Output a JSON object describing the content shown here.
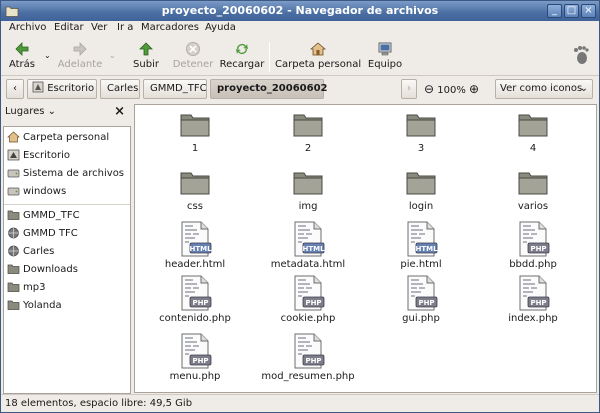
{
  "window": {
    "title": "proyecto_20060602 - Navegador de archivos"
  },
  "menu": [
    "Archivo",
    "Editar",
    "Ver",
    "Ir a",
    "Marcadores",
    "Ayuda"
  ],
  "toolbar": {
    "back": "Atrás",
    "forward": "Adelante",
    "up": "Subir",
    "stop": "Detener",
    "reload": "Recargar",
    "home": "Carpeta personal",
    "computer": "Equipo"
  },
  "location": {
    "crumbs": [
      "Escritorio",
      "Carles",
      "GMMD_TFC",
      "proyecto_20060602"
    ],
    "zoom": "100%",
    "view": "Ver como iconos"
  },
  "sidebar": {
    "header": "Lugares",
    "places": [
      "Carpeta personal",
      "Escritorio",
      "Sistema de archivos",
      "windows"
    ],
    "bookmarks": [
      "GMMD_TFC",
      "GMMD TFC",
      "Carles",
      "Downloads",
      "mp3",
      "Yolanda"
    ]
  },
  "files": [
    {
      "name": "1",
      "type": "folder"
    },
    {
      "name": "2",
      "type": "folder"
    },
    {
      "name": "3",
      "type": "folder"
    },
    {
      "name": "4",
      "type": "folder"
    },
    {
      "name": "css",
      "type": "folder"
    },
    {
      "name": "img",
      "type": "folder"
    },
    {
      "name": "login",
      "type": "folder"
    },
    {
      "name": "varios",
      "type": "folder"
    },
    {
      "name": "header.html",
      "type": "html",
      "badge": "HTML"
    },
    {
      "name": "metadata.html",
      "type": "html",
      "badge": "HTML"
    },
    {
      "name": "pie.html",
      "type": "html",
      "badge": "HTML"
    },
    {
      "name": "bbdd.php",
      "type": "php",
      "badge": "PHP"
    },
    {
      "name": "contenido.php",
      "type": "php",
      "badge": "PHP"
    },
    {
      "name": "cookie.php",
      "type": "php",
      "badge": "PHP"
    },
    {
      "name": "gui.php",
      "type": "php",
      "badge": "PHP"
    },
    {
      "name": "index.php",
      "type": "php",
      "badge": "PHP"
    },
    {
      "name": "menu.php",
      "type": "php",
      "badge": "PHP"
    },
    {
      "name": "mod_resumen.php",
      "type": "php",
      "badge": "PHP"
    }
  ],
  "status": "18 elementos, espacio libre: 49,5 Gib",
  "colors": {
    "titlebar": "#4b6fa3",
    "window_bg": "#efebe7",
    "folder": "#8a8a7e",
    "html_badge": "#6680b3",
    "php_badge": "#7d7d8a"
  }
}
